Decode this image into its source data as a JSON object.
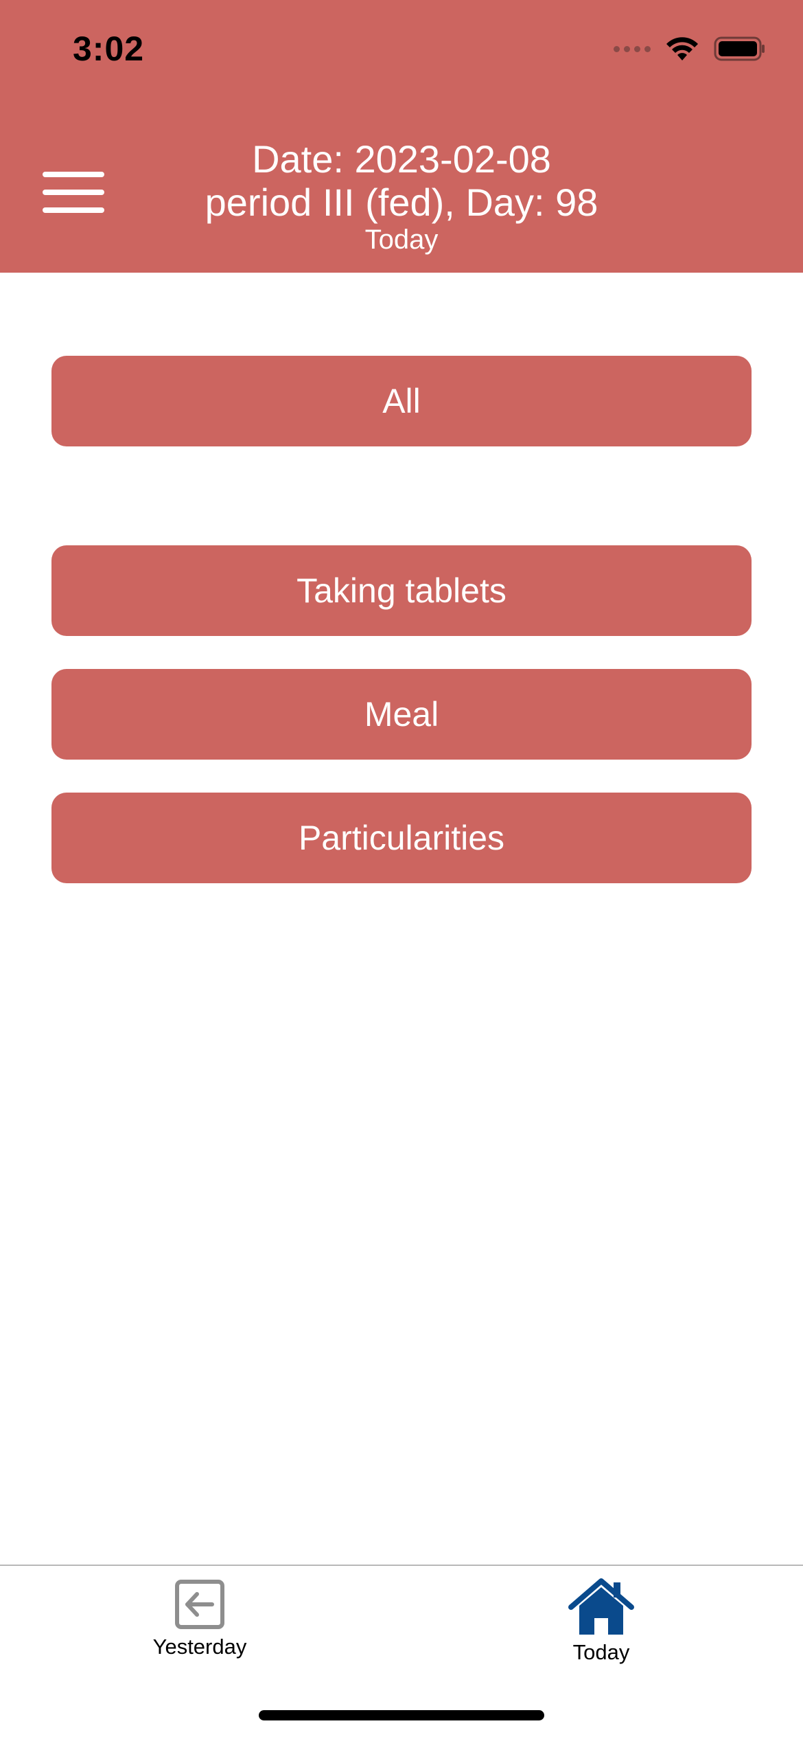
{
  "status_bar": {
    "time": "3:02"
  },
  "header": {
    "date_line": "Date: 2023-02-08",
    "period_line": "period III (fed), Day: 98",
    "sub_label": "Today"
  },
  "buttons": {
    "all": "All",
    "taking_tablets": "Taking tablets",
    "meal": "Meal",
    "particularities": "Particularities"
  },
  "tabbar": {
    "yesterday": {
      "label": "Yesterday",
      "icon": "arrow-left-box-icon"
    },
    "today": {
      "label": "Today",
      "icon": "home-icon"
    }
  },
  "colors": {
    "accent": "#cc6560",
    "tab_active": "#0a4a8c",
    "tab_inactive": "#8e8e8e"
  }
}
